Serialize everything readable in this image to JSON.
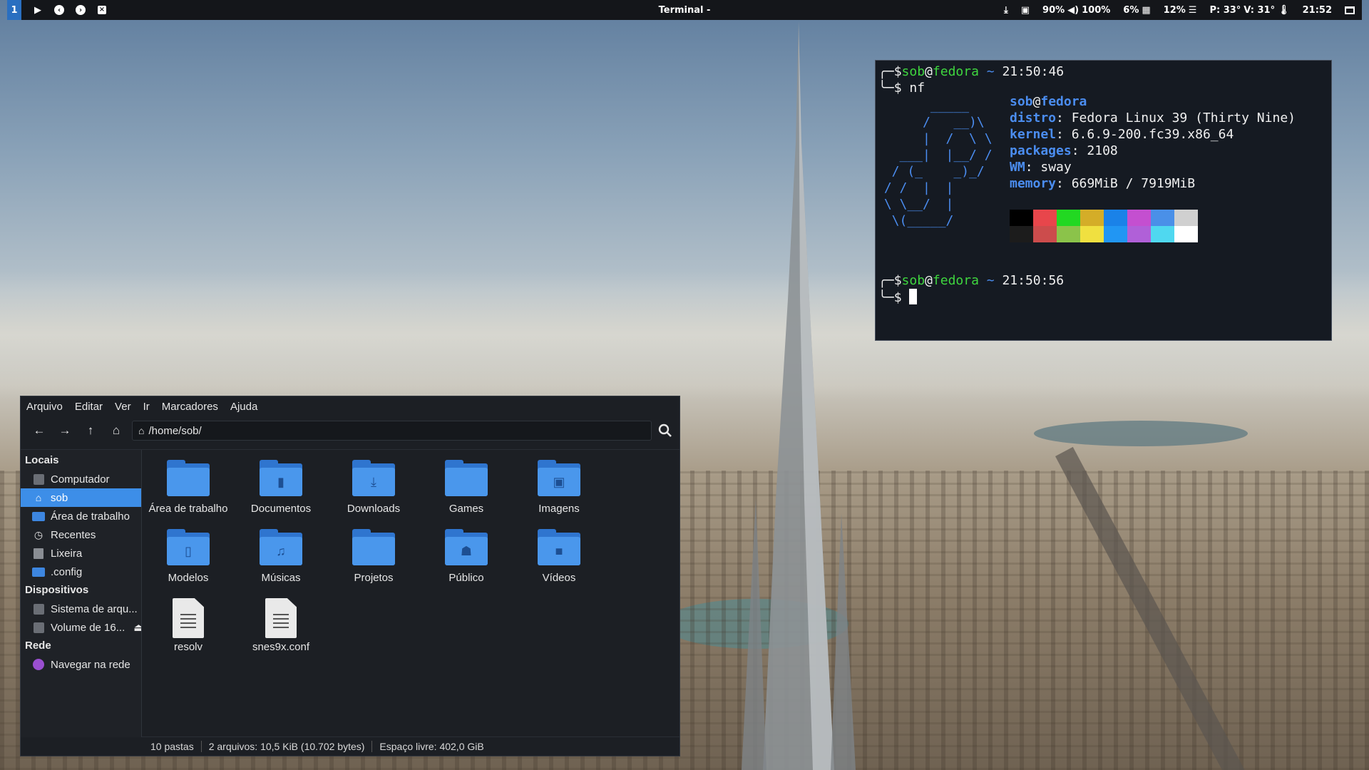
{
  "topbar": {
    "workspace": "1",
    "buttons": [
      "play-icon",
      "back-icon",
      "forward-icon",
      "close-icon"
    ],
    "window_title": "Terminal -",
    "status": {
      "download_icon": "download-icon",
      "image_icon": "image-icon",
      "brightness": "90%",
      "volume_icon": "volume-icon",
      "volume": "100%",
      "cpu": "6%",
      "cpu_icon": "cpu-icon",
      "memory": "12%",
      "memory_icon": "memory-icon",
      "power_temp": "P: 33°",
      "video_temp": "V: 31°",
      "thermometer_icon": "thermometer-icon",
      "clock": "21:52"
    }
  },
  "terminal": {
    "prompt1_user": "sob",
    "prompt1_at": "@",
    "prompt1_host": "fedora",
    "prompt1_tilde": "~",
    "prompt1_time": "21:50:46",
    "command1": "nf",
    "info_user": "sob",
    "info_host": "fedora",
    "info": [
      {
        "key": "distro",
        "value": "Fedora Linux 39 (Thirty Nine)"
      },
      {
        "key": "kernel",
        "value": "6.6.9-200.fc39.x86_64"
      },
      {
        "key": "packages",
        "value": "2108"
      },
      {
        "key": "WM",
        "value": "sway"
      },
      {
        "key": "memory",
        "value": "669MiB / 7919MiB"
      }
    ],
    "palette_top": [
      "#000000",
      "#e8464b",
      "#22d822",
      "#d4ad28",
      "#1a82e8",
      "#c44fd0",
      "#4a90e8",
      "#d0d0d0"
    ],
    "palette_bottom": [
      "#1c1c1c",
      "#cc4c4c",
      "#8bc34a",
      "#f0e040",
      "#2196f3",
      "#b060d8",
      "#4fd8f0",
      "#ffffff"
    ],
    "prompt2_user": "sob",
    "prompt2_at": "@",
    "prompt2_host": "fedora",
    "prompt2_tilde": "~",
    "prompt2_time": "21:50:56",
    "dollar": "$"
  },
  "filemanager": {
    "menu": [
      "Arquivo",
      "Editar",
      "Ver",
      "Ir",
      "Marcadores",
      "Ajuda"
    ],
    "path": "/home/sob/",
    "sidebar": {
      "sections": [
        {
          "title": "Locais",
          "items": [
            {
              "label": "Computador",
              "icon": "computer-icon"
            },
            {
              "label": "sob",
              "icon": "home-icon",
              "selected": true
            },
            {
              "label": "Área de trabalho",
              "icon": "folder-icon"
            },
            {
              "label": "Recentes",
              "icon": "clock-icon"
            },
            {
              "label": "Lixeira",
              "icon": "trash-icon"
            },
            {
              "label": ".config",
              "icon": "folder-icon"
            }
          ]
        },
        {
          "title": "Dispositivos",
          "items": [
            {
              "label": "Sistema de arqu...",
              "icon": "drive-icon"
            },
            {
              "label": "Volume de 16...",
              "icon": "drive-icon",
              "eject": "⏏"
            }
          ]
        },
        {
          "title": "Rede",
          "items": [
            {
              "label": "Navegar na rede",
              "icon": "network-icon"
            }
          ]
        }
      ]
    },
    "items": [
      {
        "label": "Área de trabalho",
        "type": "folder",
        "emblem": ""
      },
      {
        "label": "Documentos",
        "type": "folder",
        "emblem": "▮"
      },
      {
        "label": "Downloads",
        "type": "folder",
        "emblem": "⤓"
      },
      {
        "label": "Games",
        "type": "folder",
        "emblem": ""
      },
      {
        "label": "Imagens",
        "type": "folder",
        "emblem": "▣"
      },
      {
        "label": "Modelos",
        "type": "folder",
        "emblem": "▯"
      },
      {
        "label": "Músicas",
        "type": "folder",
        "emblem": "♫"
      },
      {
        "label": "Projetos",
        "type": "folder",
        "emblem": ""
      },
      {
        "label": "Público",
        "type": "folder",
        "emblem": "☗"
      },
      {
        "label": "Vídeos",
        "type": "folder",
        "emblem": "■"
      },
      {
        "label": "resolv",
        "type": "file"
      },
      {
        "label": "snes9x.conf",
        "type": "file"
      }
    ],
    "status": {
      "folders": "10 pastas",
      "files": "2 arquivos: 10,5 KiB (10.702 bytes)",
      "free": "Espaço livre: 402,0 GiB"
    }
  }
}
